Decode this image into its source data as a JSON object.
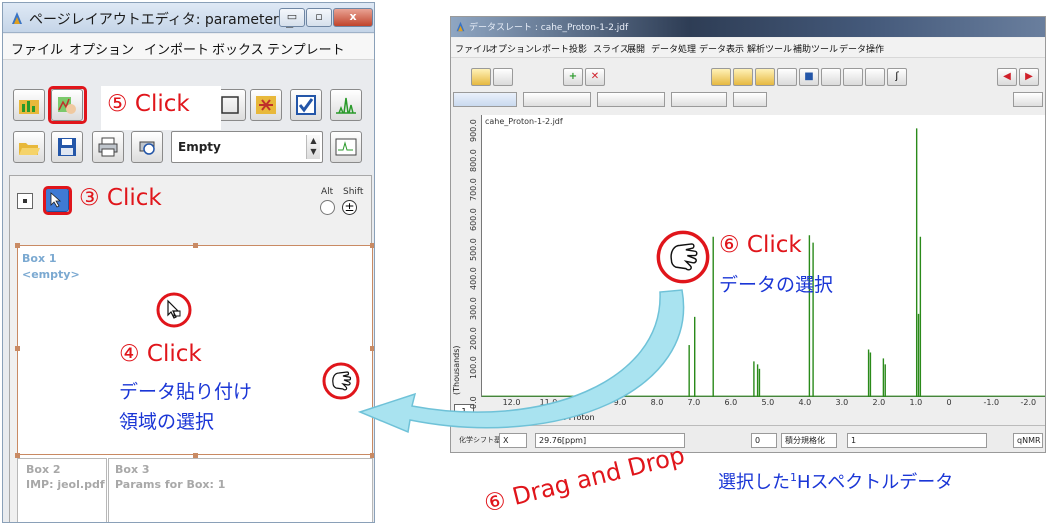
{
  "left_window": {
    "title": "ページレイアウトエディタ: parameters_b...",
    "window_controls": {
      "minimize": "▭",
      "maximize": "▫",
      "close": "x"
    },
    "menu": [
      "ファイル",
      "オプション",
      "インポート",
      "ボックス",
      "テンプレート"
    ],
    "template_select": "Empty",
    "modifiers": {
      "alt": "Alt",
      "shift": "Shift"
    },
    "box1": {
      "title": "Box 1",
      "content": "<empty>"
    },
    "box2": {
      "title": "Box 2",
      "content": "IMP: jeol.pdf"
    },
    "box3": {
      "title": "Box 3",
      "content": "Params for Box: 1"
    }
  },
  "right_window": {
    "title": "データスレート : cahe_Proton-1-2.jdf",
    "menu": [
      "ファイル",
      "オプション",
      "レポート",
      "投影",
      "スライス",
      "展開",
      "データ処理",
      "データ表示",
      "解析ツール",
      "補助ツール",
      "データ操作"
    ],
    "plot": {
      "file_label": "cahe_Proton-1-2.jdf",
      "x_axis_label": "X : parts per Million : Proton",
      "y_axis_label": "(Thousands)",
      "page_tab": "1"
    },
    "status": {
      "label": "化学シフト基準",
      "axis": "X",
      "value": "29.76[ppm]",
      "page": "0",
      "mode": "積分規格化",
      "count": "1",
      "button": "qNMR"
    }
  },
  "chart_data": {
    "type": "line",
    "x_ticks": [
      "12.0",
      "11.0",
      "10.0",
      "9.0",
      "8.0",
      "7.0",
      "6.0",
      "5.0",
      "4.0",
      "3.0",
      "2.0",
      "1.0",
      "0",
      "-1.0",
      "-2.0"
    ],
    "y_ticks": [
      "0.0",
      "100.0",
      "200.0",
      "300.0",
      "400.0",
      "500.0",
      "600.0",
      "700.0",
      "800.0",
      "900.0"
    ],
    "xlim": [
      12.8,
      -2.5
    ],
    "ylim": [
      0,
      950
    ],
    "peaks": [
      {
        "x": 7.2,
        "y": 175
      },
      {
        "x": 7.05,
        "y": 270
      },
      {
        "x": 6.55,
        "y": 540
      },
      {
        "x": 5.45,
        "y": 120
      },
      {
        "x": 5.35,
        "y": 110
      },
      {
        "x": 5.3,
        "y": 95
      },
      {
        "x": 3.95,
        "y": 545
      },
      {
        "x": 3.85,
        "y": 520
      },
      {
        "x": 2.35,
        "y": 160
      },
      {
        "x": 2.3,
        "y": 150
      },
      {
        "x": 1.95,
        "y": 130
      },
      {
        "x": 1.9,
        "y": 110
      },
      {
        "x": 1.05,
        "y": 905
      },
      {
        "x": 1.0,
        "y": 280
      },
      {
        "x": 0.95,
        "y": 540
      }
    ]
  },
  "annotations": {
    "step3": "③ Click",
    "step4": "④ Click",
    "step4_desc_1": "データ貼り付け",
    "step4_desc_2": "領域の選択",
    "step5": "⑤ Click",
    "step6_click": "⑥ Click",
    "step6_desc": "データの選択",
    "step6_drag": "⑥ Drag and Drop",
    "caption_prefix": "選択した",
    "caption_sup": "1",
    "caption_suffix": "Hスペクトルデータ"
  },
  "colors": {
    "callout_red": "#e0151b",
    "callout_blue": "#1a36d6",
    "spectrum_green": "#2a8a1a",
    "arrow_cyan": "#9fe0ef"
  }
}
